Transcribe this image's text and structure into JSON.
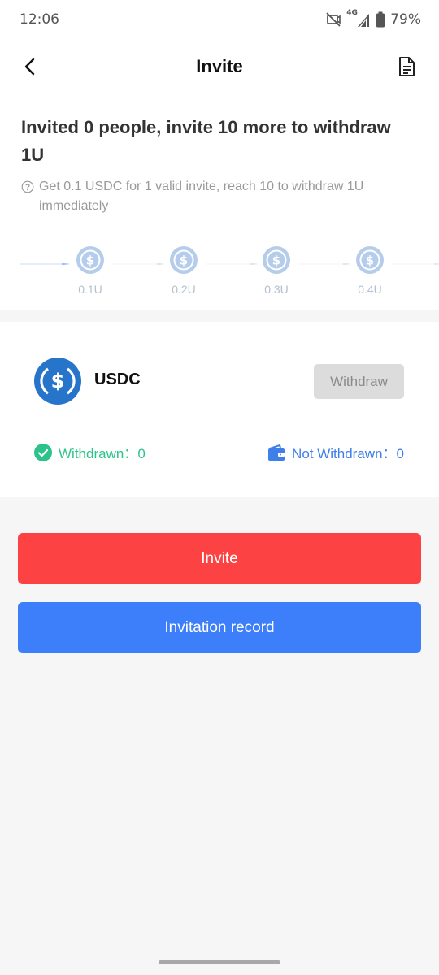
{
  "status_bar": {
    "time": "12:06",
    "network": "4G",
    "battery": "79%"
  },
  "nav": {
    "title": "Invite",
    "back_icon": "chevron-left-icon",
    "doc_icon": "document-icon"
  },
  "invite_summary": {
    "headline": "Invited 0 people, invite 10 more to withdraw 1U",
    "hint": "Get 0.1 USDC for 1 valid invite, reach 10 to withdraw 1U immediately"
  },
  "progress": {
    "steps": [
      {
        "label": "0.1U"
      },
      {
        "label": "0.2U"
      },
      {
        "label": "0.3U"
      },
      {
        "label": "0.4U"
      }
    ]
  },
  "wallet": {
    "coin": "USDC",
    "withdraw_label": "Withdraw",
    "withdrawn_label": "Withdrawn：",
    "withdrawn_value": "0",
    "not_withdrawn_label": "Not Withdrawn：",
    "not_withdrawn_value": "0"
  },
  "actions": {
    "invite_label": "Invite",
    "record_label": "Invitation record"
  },
  "colors": {
    "invite": "#fc4242",
    "record": "#3d7efa",
    "withdrawn": "#2cc38b",
    "not_withdrawn": "#3f7fe9",
    "usdc": "#2775ca"
  }
}
